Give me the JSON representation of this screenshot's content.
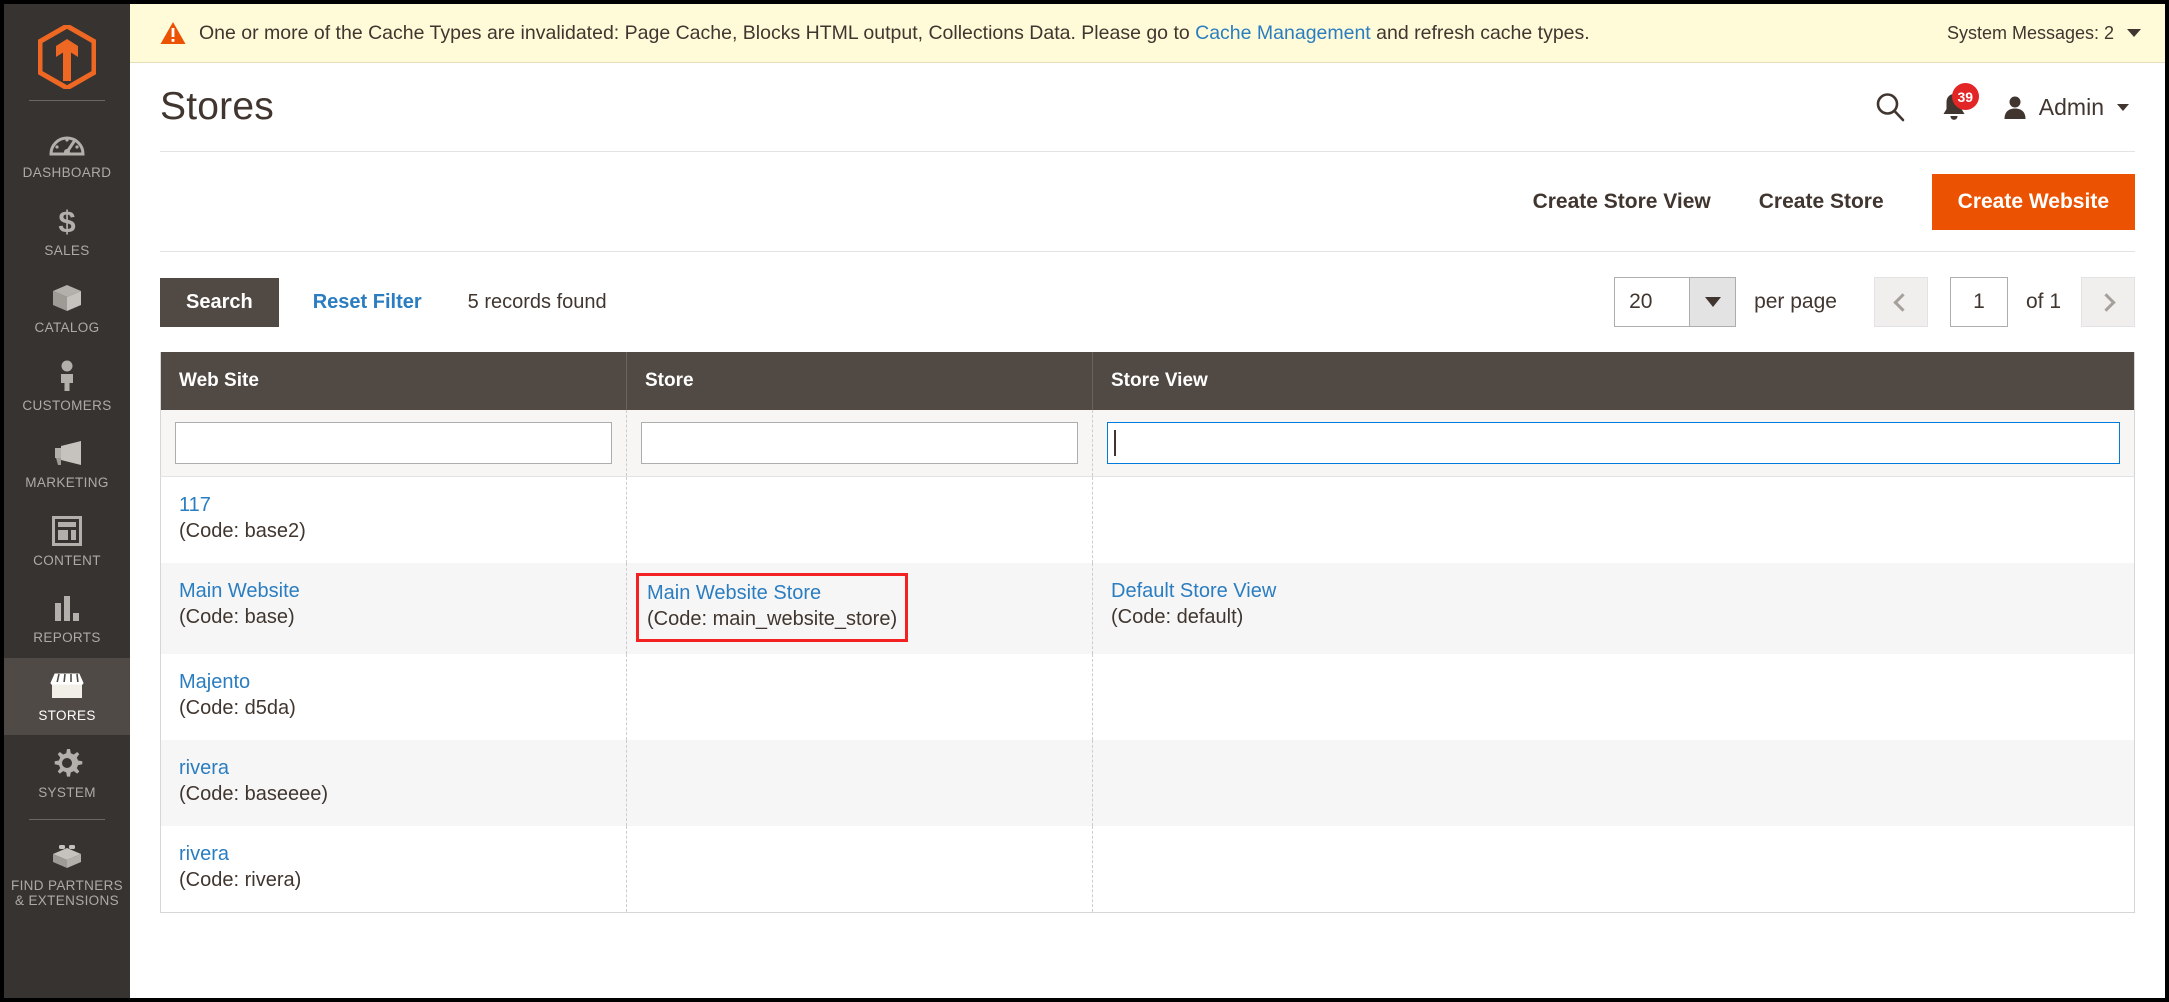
{
  "sidebar": {
    "logo_name": "magento-logo",
    "items": [
      {
        "label": "DASHBOARD",
        "icon": "dashboard-gauge-icon",
        "active": false
      },
      {
        "label": "SALES",
        "icon": "dollar-sign-icon",
        "active": false
      },
      {
        "label": "CATALOG",
        "icon": "box-icon",
        "active": false
      },
      {
        "label": "CUSTOMERS",
        "icon": "person-icon",
        "active": false
      },
      {
        "label": "MARKETING",
        "icon": "megaphone-icon",
        "active": false
      },
      {
        "label": "CONTENT",
        "icon": "layout-grid-icon",
        "active": false
      },
      {
        "label": "REPORTS",
        "icon": "bar-chart-icon",
        "active": false
      },
      {
        "label": "STORES",
        "icon": "storefront-awning-icon",
        "active": true
      },
      {
        "label": "SYSTEM",
        "icon": "gear-icon",
        "active": false
      },
      {
        "label": "FIND PARTNERS\n& EXTENSIONS",
        "label_line1": "FIND PARTNERS",
        "label_line2": "& EXTENSIONS",
        "icon": "lego-brick-icon",
        "active": false
      }
    ]
  },
  "system_message": {
    "icon": "warning-triangle-icon",
    "text_before_link": "One or more of the Cache Types are invalidated: Page Cache, Blocks HTML output, Collections Data. Please go to ",
    "link_text": "Cache Management",
    "text_after_link": " and refresh cache types.",
    "counter_label": "System Messages: 2",
    "bg_color": "#fffbd8",
    "link_color": "#2a7dc0"
  },
  "header": {
    "title": "Stores",
    "search_icon": "search-icon",
    "notifications_icon": "bell-icon",
    "notifications_count": "39",
    "notifications_badge_color": "#e22626",
    "admin_icon": "user-avatar-icon",
    "admin_label": "Admin"
  },
  "actions": {
    "create_store_view": "Create Store View",
    "create_store": "Create Store",
    "create_website": "Create Website",
    "primary_color": "#eb5202"
  },
  "toolbar": {
    "search_label": "Search",
    "reset_filter_label": "Reset Filter",
    "records_found": "5 records found",
    "per_page_value": "20",
    "per_page_label": "per page",
    "prev_page_icon": "chevron-left-icon",
    "next_page_icon": "chevron-right-icon",
    "current_page": "1",
    "of_pages": "of 1"
  },
  "grid": {
    "columns": [
      "Web Site",
      "Store",
      "Store View"
    ],
    "filters": {
      "website": {
        "value": "",
        "placeholder": "",
        "focused": false
      },
      "store": {
        "value": "",
        "placeholder": "",
        "focused": false
      },
      "store_view": {
        "value": "",
        "placeholder": "",
        "focused": true
      }
    },
    "rows": [
      {
        "website_name": "117",
        "website_code": "(Code: base2)",
        "store_name": "",
        "store_code": "",
        "view_name": "",
        "view_code": "",
        "highlight": false
      },
      {
        "website_name": "Main Website",
        "website_code": "(Code: base)",
        "store_name": "Main Website Store",
        "store_code": "(Code: main_website_store)",
        "view_name": "Default Store View",
        "view_code": "(Code: default)",
        "highlight": true
      },
      {
        "website_name": "Majento",
        "website_code": "(Code: d5da)",
        "store_name": "",
        "store_code": "",
        "view_name": "",
        "view_code": "",
        "highlight": false
      },
      {
        "website_name": "rivera",
        "website_code": "(Code: baseeee)",
        "store_name": "",
        "store_code": "",
        "view_name": "",
        "view_code": "",
        "highlight": false
      },
      {
        "website_name": "rivera",
        "website_code": "(Code: rivera)",
        "store_name": "",
        "store_code": "",
        "view_name": "",
        "view_code": "",
        "highlight": false
      }
    ],
    "highlight_color": "#f32121"
  }
}
